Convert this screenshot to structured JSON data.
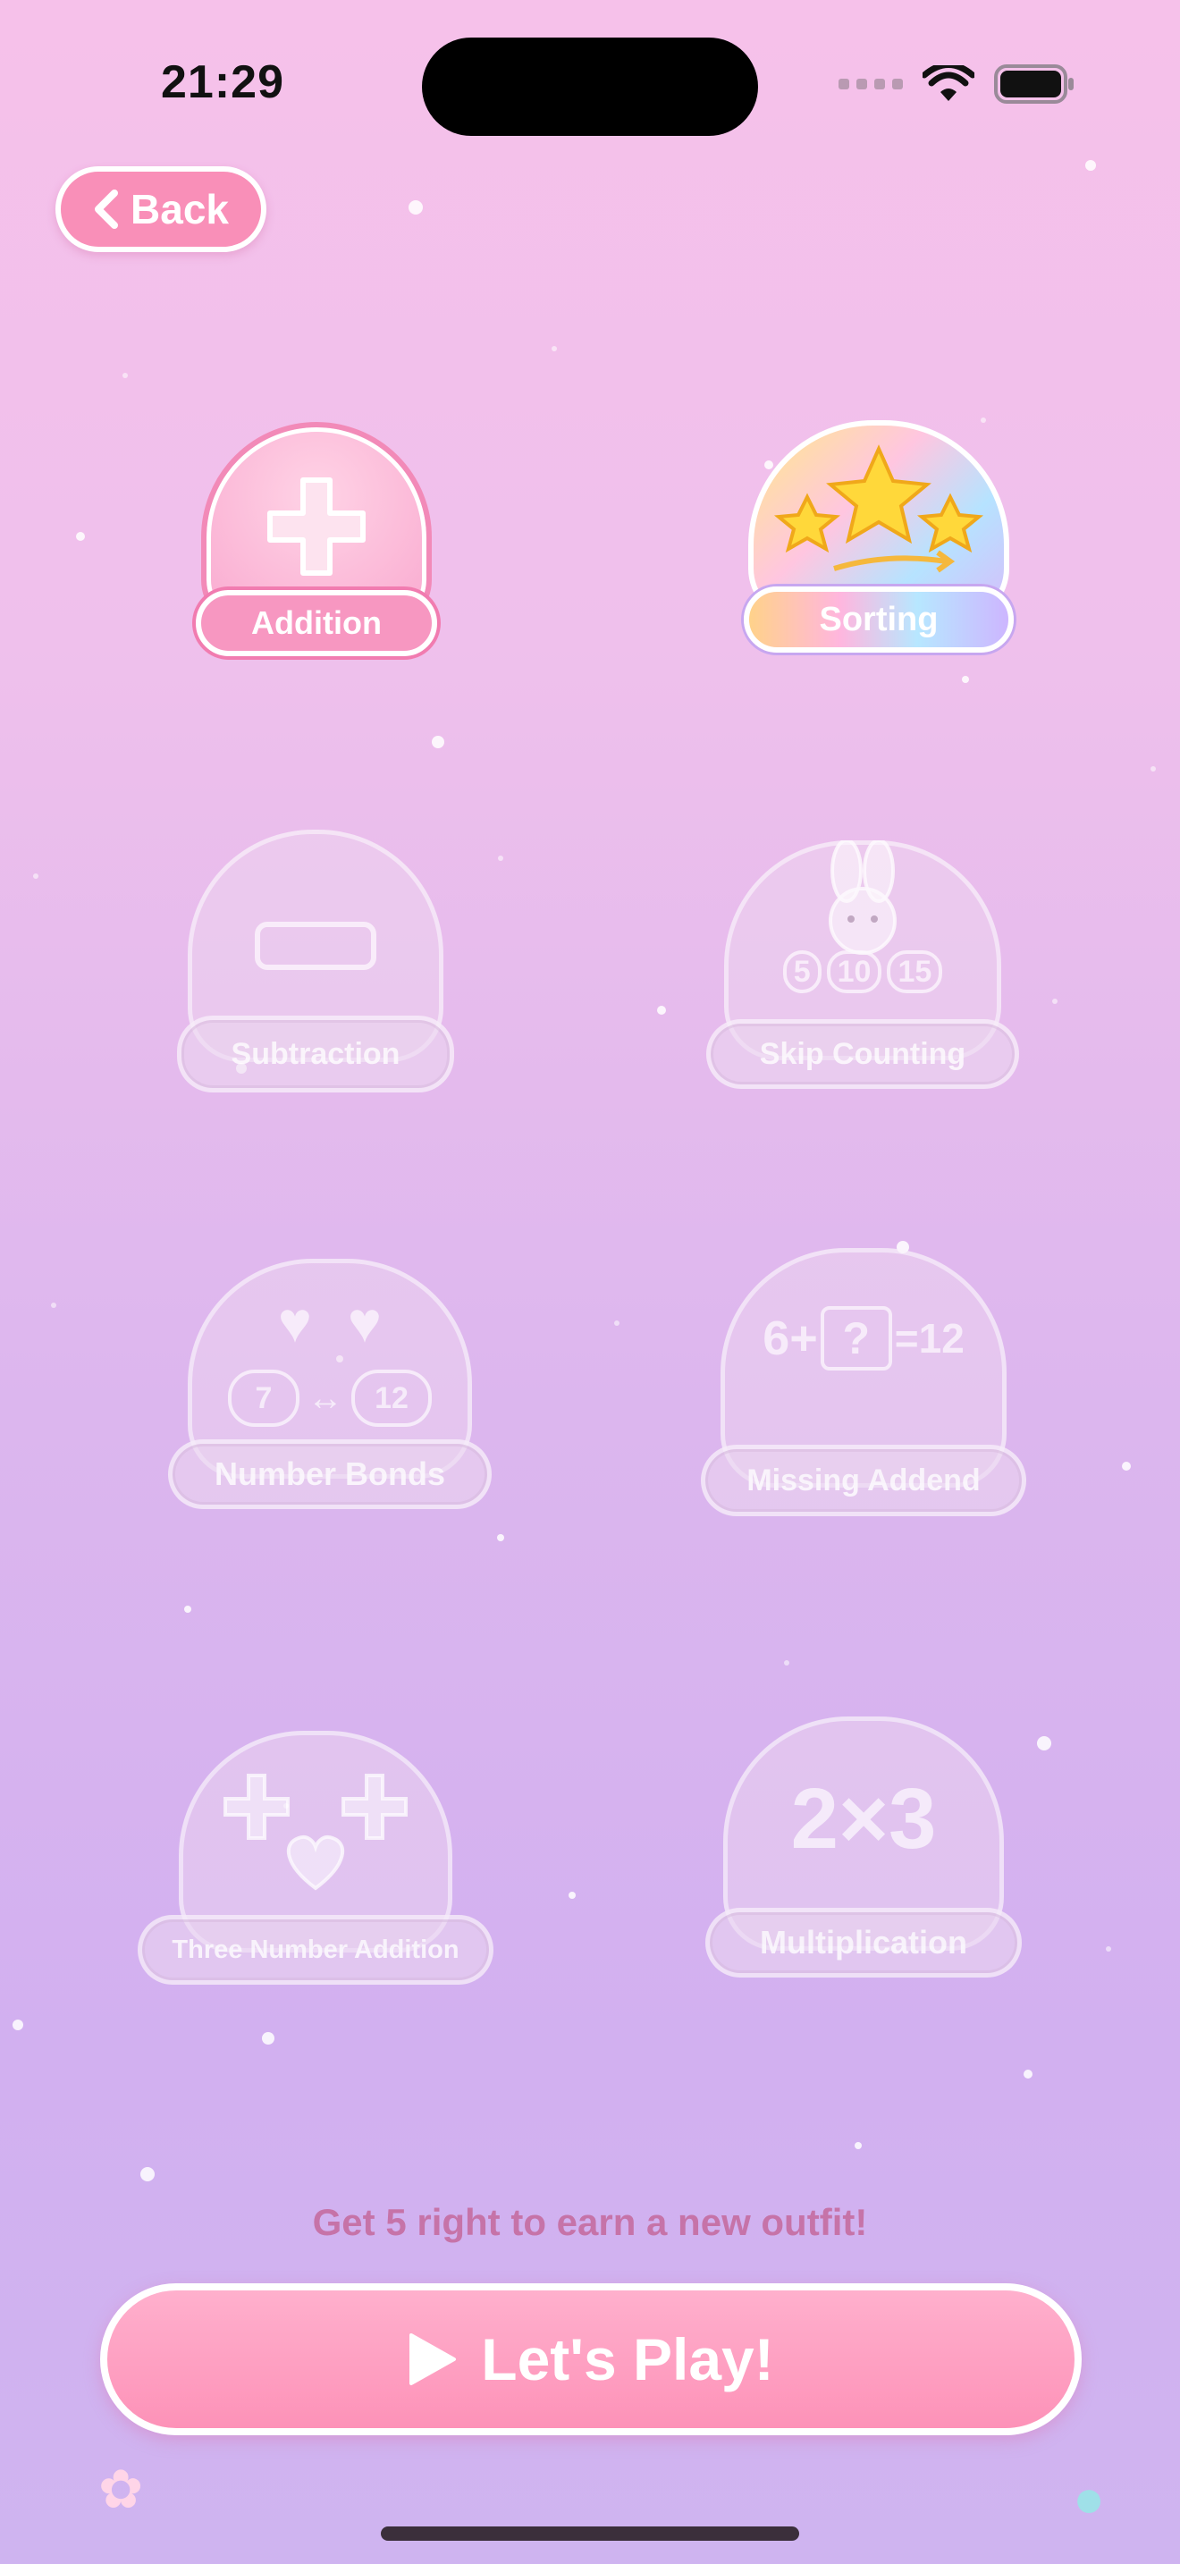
{
  "status_bar": {
    "time": "21:29"
  },
  "back": {
    "label": "Back"
  },
  "games": [
    {
      "name": "Addition",
      "locked": false
    },
    {
      "name": "Sorting",
      "locked": false
    },
    {
      "name": "Subtraction",
      "locked": true
    },
    {
      "name": "Skip Counting",
      "locked": true,
      "art": [
        "5",
        "10",
        "15"
      ]
    },
    {
      "name": "Number Bonds",
      "locked": true,
      "art": [
        "7",
        "↔",
        "12"
      ]
    },
    {
      "name": "Missing Addend",
      "locked": true,
      "art": [
        "6+",
        "?",
        "=12"
      ]
    },
    {
      "name": "Three Number Addition",
      "locked": true
    },
    {
      "name": "Multiplication",
      "locked": true,
      "art": [
        "2×3"
      ]
    }
  ],
  "hint": "Get 5 right to earn a new outfit!",
  "play": {
    "label": "Let's Play!"
  },
  "colors": {
    "accent": "#f98fb8",
    "hint": "#c673a8"
  }
}
